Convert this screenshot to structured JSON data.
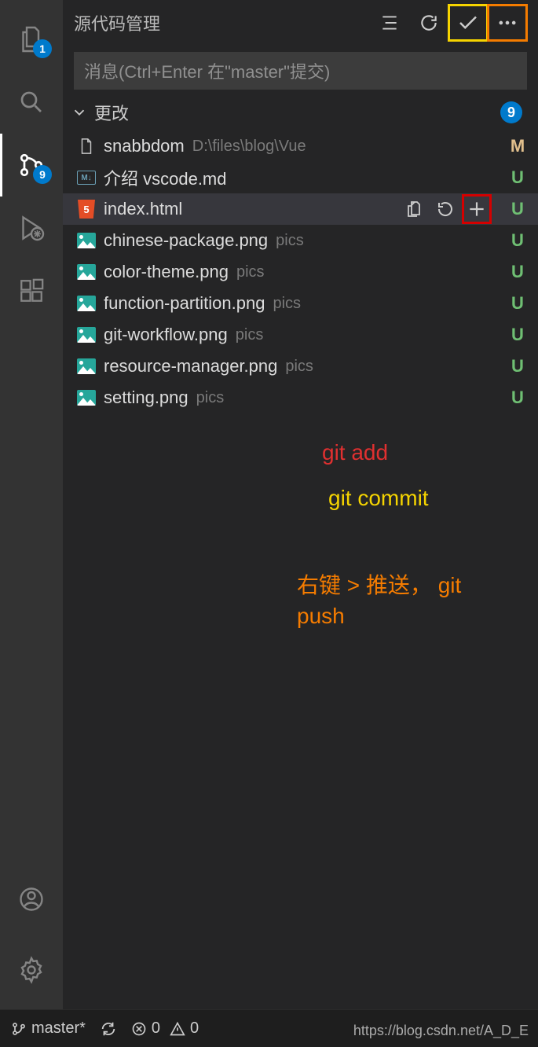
{
  "activity": {
    "explorer_badge": "1",
    "scm_badge": "9"
  },
  "scm": {
    "title": "源代码管理",
    "commit_placeholder": "消息(Ctrl+Enter 在\"master\"提交)",
    "changes_label": "更改",
    "changes_count": "9",
    "files": [
      {
        "icon": "file",
        "name": "snabbdom",
        "path": "D:\\files\\blog\\Vue",
        "status": "M",
        "hovered": false
      },
      {
        "icon": "md",
        "name": "介绍 vscode.md",
        "path": "",
        "status": "U",
        "hovered": false
      },
      {
        "icon": "html",
        "name": "index.html",
        "path": "",
        "status": "U",
        "hovered": true
      },
      {
        "icon": "img",
        "name": "chinese-package.png",
        "path": "pics",
        "status": "U",
        "hovered": false
      },
      {
        "icon": "img",
        "name": "color-theme.png",
        "path": "pics",
        "status": "U",
        "hovered": false
      },
      {
        "icon": "img",
        "name": "function-partition.png",
        "path": "pics",
        "status": "U",
        "hovered": false
      },
      {
        "icon": "img",
        "name": "git-workflow.png",
        "path": "pics",
        "status": "U",
        "hovered": false
      },
      {
        "icon": "img",
        "name": "resource-manager.png",
        "path": "pics",
        "status": "U",
        "hovered": false
      },
      {
        "icon": "img",
        "name": "setting.png",
        "path": "pics",
        "status": "U",
        "hovered": false
      }
    ]
  },
  "annotations": {
    "git_add": "git  add",
    "git_commit": "git commit",
    "git_push": "右键 > 推送，  git push"
  },
  "statusbar": {
    "branch": "master*",
    "errors": "0",
    "warnings": "0"
  },
  "watermark": "https://blog.csdn.net/A_D_E"
}
